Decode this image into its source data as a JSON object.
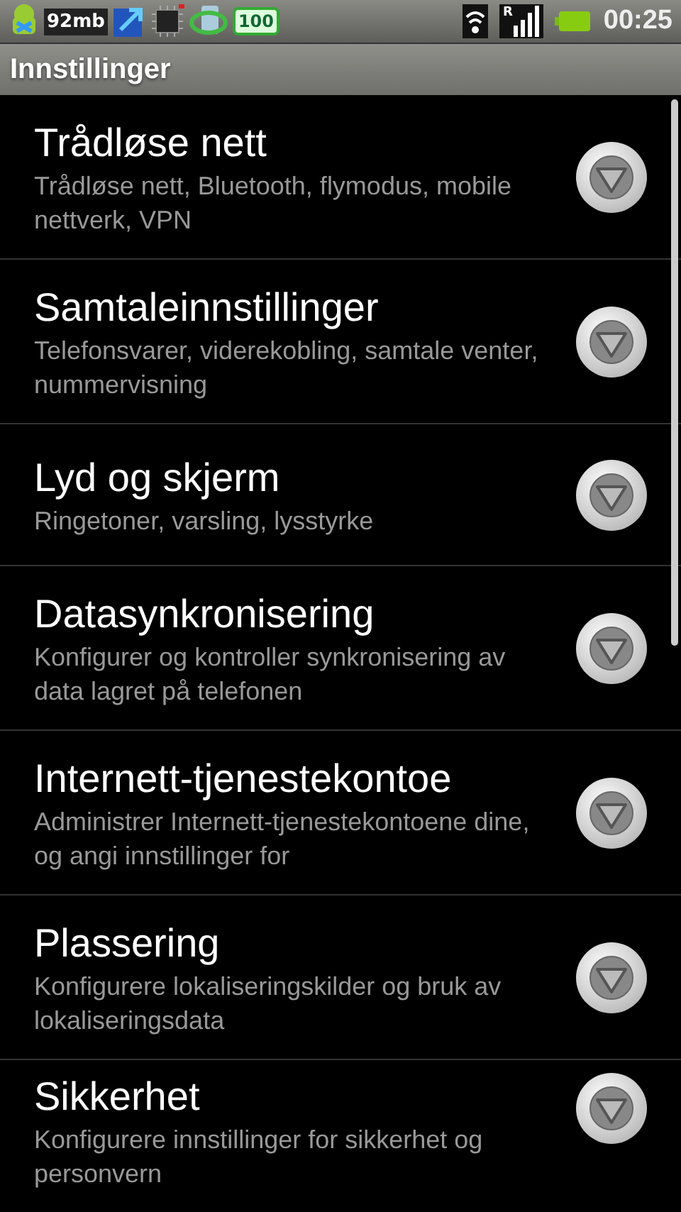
{
  "status_bar": {
    "memory": "92mb",
    "battery_badge": "100",
    "roaming": "R",
    "time": "00:25"
  },
  "title": "Innstillinger",
  "items": [
    {
      "title": "Trådløse nett",
      "summary": "Trådløse nett, Bluetooth, flymodus, mobile nettverk, VPN"
    },
    {
      "title": "Samtaleinnstillinger",
      "summary": "Telefonsvarer, viderekobling, samtale venter, nummervisning"
    },
    {
      "title": "Lyd og skjerm",
      "summary": "Ringetoner, varsling, lysstyrke"
    },
    {
      "title": "Datasynkronisering",
      "summary": "Konfigurer og kontroller synkronisering av data lagret på telefonen"
    },
    {
      "title": "Internett-tjenestekontoe",
      "summary": "Administrer Internett-tjenestekontoene dine, og angi innstillinger for"
    },
    {
      "title": "Plassering",
      "summary": "Konfigurere lokaliseringskilder og bruk av lokaliseringsdata"
    },
    {
      "title": "Sikkerhet",
      "summary": "Konfigurere innstillinger for sikkerhet og personvern"
    }
  ]
}
